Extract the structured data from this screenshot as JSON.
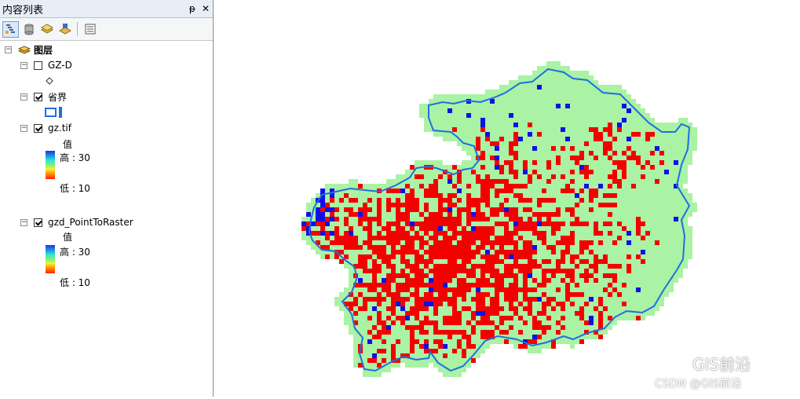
{
  "panel": {
    "title": "内容列表",
    "pin_glyph": "ᵽ",
    "close_glyph": "✕"
  },
  "toolbar": {
    "buttons": [
      "list-by-drawing-order-icon",
      "list-by-source-icon",
      "list-by-visibility-icon",
      "list-by-selection-icon",
      "options-icon"
    ]
  },
  "tree": {
    "root_label": "图层",
    "layers": [
      {
        "name": "GZ-D",
        "checked": false,
        "symbol": "point-symbol-icon"
      },
      {
        "name": "省界",
        "checked": true,
        "symbol": "polygon-symbol-icon"
      },
      {
        "name": "gz.tif",
        "checked": true,
        "legend_title": "值",
        "high": "高 : 30",
        "low": "低 : 10"
      },
      {
        "name": "gzd_PointToRaster",
        "checked": true,
        "legend_title": "值",
        "high": "高 : 30",
        "low": "低 : 10"
      }
    ]
  },
  "map": {
    "colors": {
      "green": "#aaf2a4",
      "red": "#f50000",
      "blue": "#1010e6",
      "boundary": "#1f6fe0"
    }
  },
  "watermark": {
    "text": "GIS前沿",
    "csdn": "CSDN @GIS前沿"
  }
}
